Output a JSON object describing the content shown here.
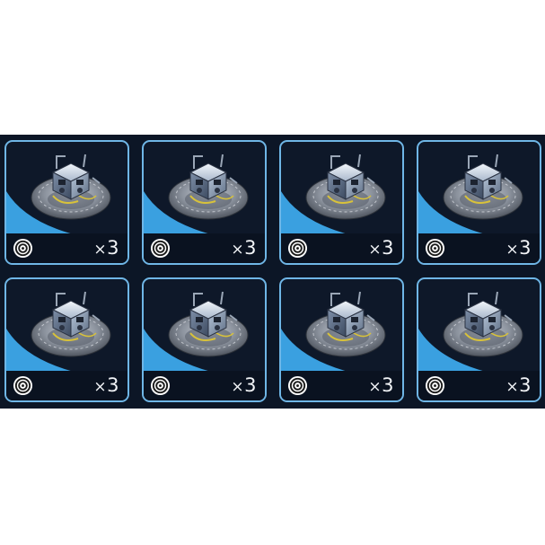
{
  "inventory": {
    "items": [
      {
        "icon": "reactor-module-icon",
        "badge_icon": "target-icon",
        "quantity": "3",
        "multiplier": "×"
      },
      {
        "icon": "reactor-module-icon",
        "badge_icon": "target-icon",
        "quantity": "3",
        "multiplier": "×"
      },
      {
        "icon": "reactor-module-icon",
        "badge_icon": "target-icon",
        "quantity": "3",
        "multiplier": "×"
      },
      {
        "icon": "reactor-module-icon",
        "badge_icon": "target-icon",
        "quantity": "3",
        "multiplier": "×"
      },
      {
        "icon": "reactor-module-icon",
        "badge_icon": "target-icon",
        "quantity": "3",
        "multiplier": "×"
      },
      {
        "icon": "reactor-module-icon",
        "badge_icon": "target-icon",
        "quantity": "3",
        "multiplier": "×"
      },
      {
        "icon": "reactor-module-icon",
        "badge_icon": "target-icon",
        "quantity": "3",
        "multiplier": "×"
      },
      {
        "icon": "reactor-module-icon",
        "badge_icon": "target-icon",
        "quantity": "3",
        "multiplier": "×"
      }
    ]
  },
  "colors": {
    "panel_bg": "#0c1626",
    "card_border": "#6fb6e6",
    "accent_blue": "#3aa0e0",
    "text": "#f2f4f7"
  }
}
